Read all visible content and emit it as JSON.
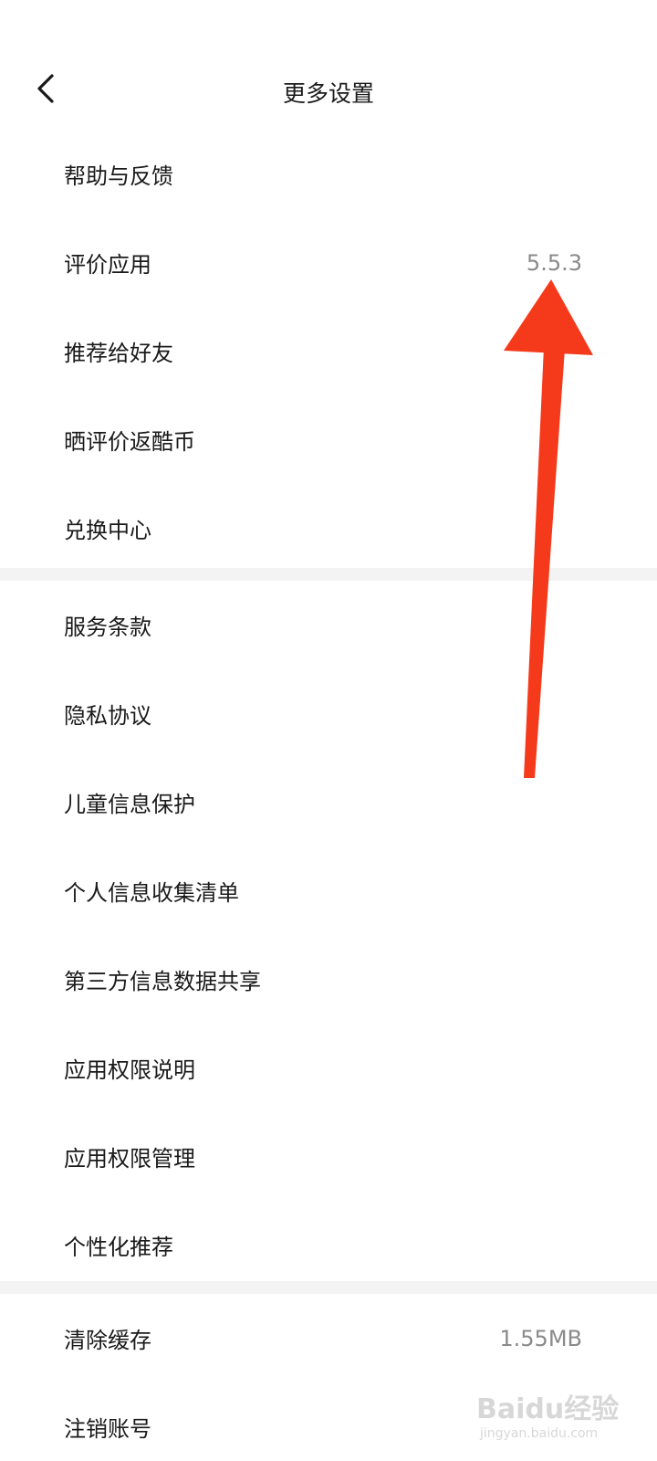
{
  "header": {
    "title": "更多设置",
    "back_icon": "chevron-left-icon"
  },
  "groups": [
    {
      "items": [
        {
          "label": "帮助与反馈",
          "value": ""
        },
        {
          "label": "评价应用",
          "value": "5.5.3"
        },
        {
          "label": "推荐给好友",
          "value": ""
        },
        {
          "label": "晒评价返酷币",
          "value": ""
        },
        {
          "label": "兑换中心",
          "value": ""
        }
      ]
    },
    {
      "items": [
        {
          "label": "服务条款",
          "value": ""
        },
        {
          "label": "隐私协议",
          "value": ""
        },
        {
          "label": "儿童信息保护",
          "value": ""
        },
        {
          "label": "个人信息收集清单",
          "value": ""
        },
        {
          "label": "第三方信息数据共享",
          "value": ""
        },
        {
          "label": "应用权限说明",
          "value": ""
        },
        {
          "label": "应用权限管理",
          "value": ""
        },
        {
          "label": "个性化推荐",
          "value": ""
        }
      ]
    },
    {
      "items": [
        {
          "label": "清除缓存",
          "value": "1.55MB"
        },
        {
          "label": "注销账号",
          "value": ""
        }
      ]
    }
  ],
  "annotation": {
    "color": "#f53a1c"
  },
  "watermark": {
    "logo": "Baidu经验",
    "url": "jingyan.baidu.com"
  },
  "colors": {
    "background": "#ffffff",
    "divider": "#f3f3f3",
    "text": "#1a1a1a",
    "secondary_text": "#8a8a8a"
  }
}
